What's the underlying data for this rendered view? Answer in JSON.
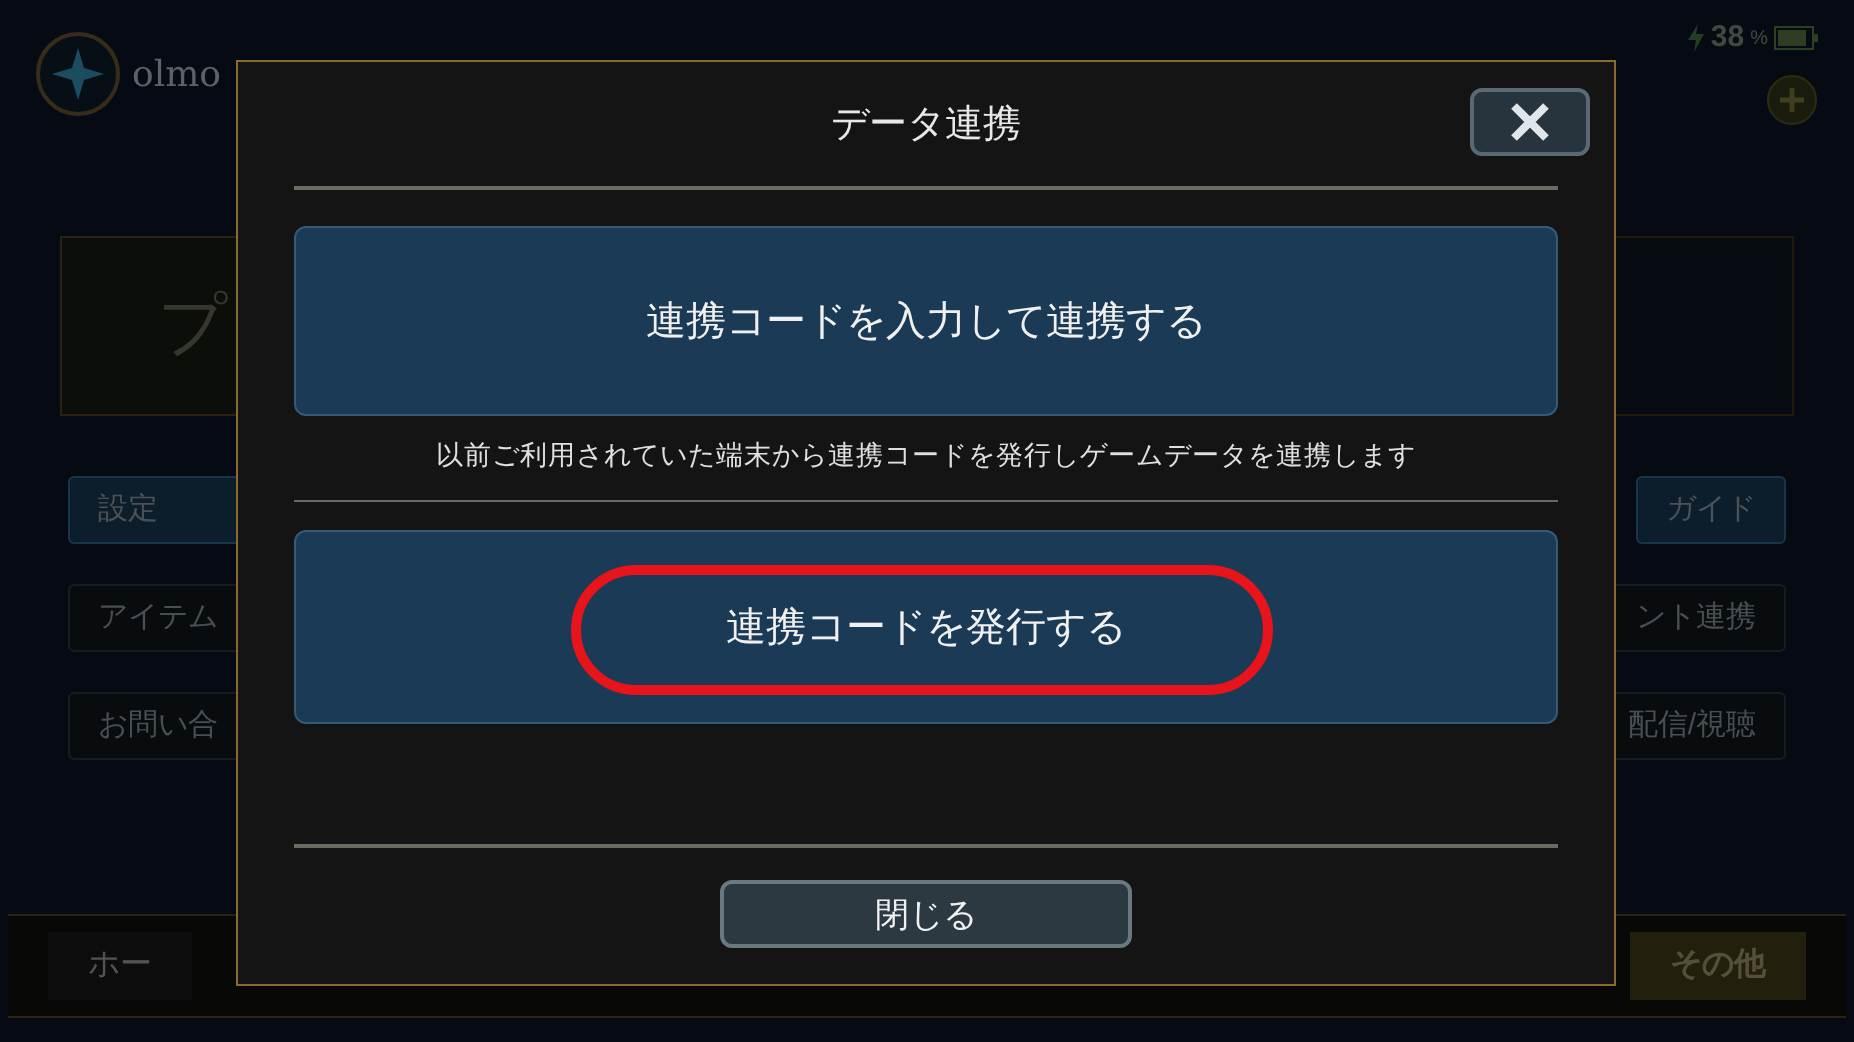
{
  "status_bar": {
    "battery": "38",
    "battery_unit": "%"
  },
  "player": {
    "name": "olmo"
  },
  "profile_panel": {
    "label": "プ"
  },
  "menu_left": [
    {
      "label": "設定",
      "selected": true
    },
    {
      "label": "アイテム",
      "selected": false
    },
    {
      "label": "お問い合",
      "selected": false
    }
  ],
  "menu_right": [
    {
      "label": "ガイド",
      "selected": true
    },
    {
      "label": "ント連携",
      "selected": false
    },
    {
      "label": "配信/視聴",
      "selected": false
    }
  ],
  "bottom_nav": [
    {
      "label": "ホー",
      "selected": false
    },
    {
      "label": "その他",
      "selected": true
    }
  ],
  "dialog": {
    "title": "データ連携",
    "input_button": "連携コードを入力して連携する",
    "description": "以前ご利用されていた端末から連携コードを発行しゲームデータを連携します",
    "issue_button": "連携コードを発行する",
    "issue_highlighted": true,
    "close_button": "閉じる"
  }
}
